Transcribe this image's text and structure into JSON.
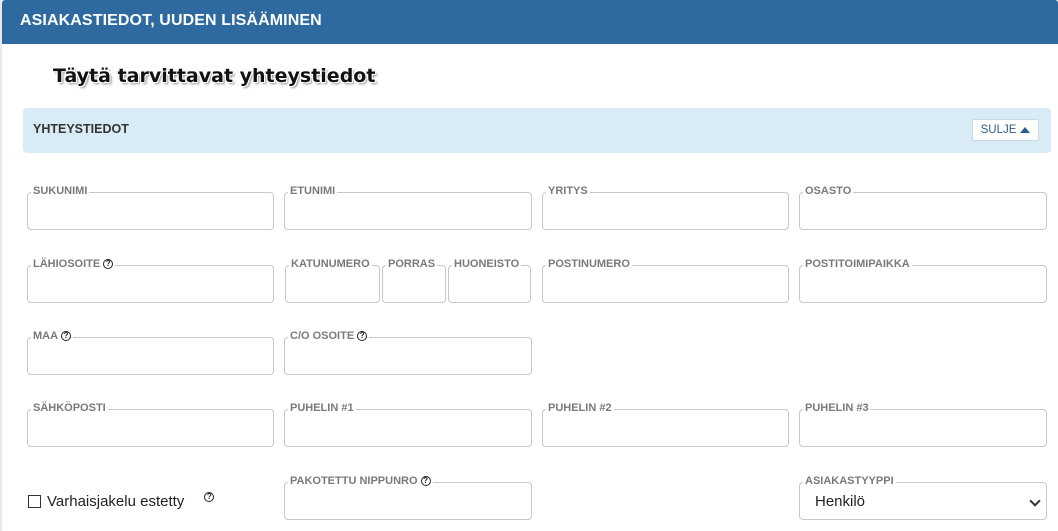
{
  "window": {
    "title": "ASIAKASTIEDOT, UUDEN LISÄÄMINEN"
  },
  "callout": "Täytä tarvittavat yhteystiedot",
  "section": {
    "title": "YHTEYSTIEDOT",
    "close_label": "SULJE"
  },
  "fields": {
    "sukunimi": "SUKUNIMI",
    "etunimi": "ETUNIMI",
    "yritys": "YRITYS",
    "osasto": "OSASTO",
    "lahiosoite": "LÄHIOSOITE",
    "katunumero": "KATUNUMERO",
    "porras": "PORRAS",
    "huoneisto": "HUONEISTO",
    "postinumero": "POSTINUMERO",
    "postitoimipaikka": "POSTITOIMIPAIKKA",
    "maa": "MAA",
    "co_osoite": "C/O OSOITE",
    "sahkoposti": "SÄHKÖPOSTI",
    "puhelin1": "PUHELIN #1",
    "puhelin2": "PUHELIN #2",
    "puhelin3": "PUHELIN #3",
    "pakotettu_nippunro": "PAKOTETTU NIPPUNRO",
    "asiakastyyppi": "ASIAKASTYYPPI"
  },
  "asiakastyyppi_value": "Henkilö",
  "checkbox": {
    "label": "Varhaisjakelu estetty",
    "checked": false
  },
  "help_glyph": "?",
  "colors": {
    "header": "#2e6aa0",
    "section_bg": "#d9ebf5"
  }
}
